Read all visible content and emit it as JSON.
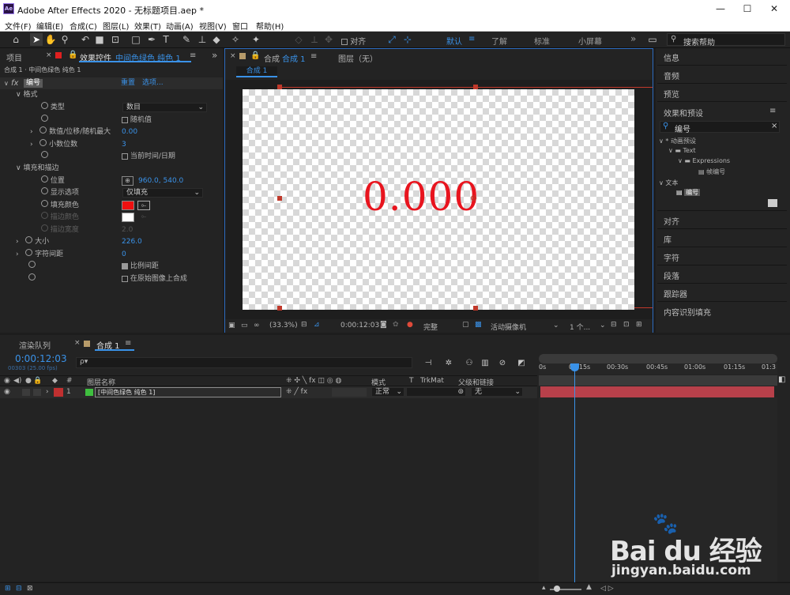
{
  "title": "Adobe After Effects 2020 - 无标题项目.aep *",
  "app_icon": "Ae",
  "window_controls": {
    "minimize": "—",
    "maximize": "☐",
    "close": "✕"
  },
  "menu": [
    "文件(F)",
    "编辑(E)",
    "合成(C)",
    "图层(L)",
    "效果(T)",
    "动画(A)",
    "视图(V)",
    "窗口",
    "帮助(H)"
  ],
  "toolbar": {
    "align_label": "对齐",
    "workspaces": [
      "默认",
      "了解",
      "标准",
      "小屏幕"
    ],
    "more": "»",
    "search_placeholder": "搜索帮助"
  },
  "left_panel": {
    "tab_project": "项目",
    "tab_effects": "效果控件",
    "tab_effects_layer": "中间色绿色 纯色 1",
    "menu_icon": "≡",
    "more": "»",
    "breadcrumb": "合成 1 · 中间色绿色 纯色 1",
    "fx_badge": "fx",
    "effect_name": "编号",
    "reset": "重置",
    "options": "选项...",
    "group_format": "格式",
    "type_label": "类型",
    "type_value": "数目",
    "random_label": "随机值",
    "value_label": "数值/位移/随机最大",
    "value": "0.00",
    "decimals_label": "小数位数",
    "decimals": "3",
    "datetime_label": "当前时间/日期",
    "group_fill": "填充和描边",
    "position_label": "位置",
    "position_value": "960.0, 540.0",
    "display_label": "显示选项",
    "display_value": "仅填充",
    "fill_color_label": "填充颜色",
    "stroke_color_label": "描边颜色",
    "stroke_width_label": "描边宽度",
    "stroke_width": "2.0",
    "size_label": "大小",
    "size": "226.0",
    "tracking_label": "字符间距",
    "tracking": "0",
    "proportional_label": "比例间距",
    "composite_label": "在原始图像上合成"
  },
  "comp_panel": {
    "tab_comp": "合成",
    "tab_comp_name": "合成 1",
    "menu_icon": "≡",
    "layer_tab": "图层（无）",
    "sub_tab": "合成 1",
    "display_text": "0.000",
    "text_color": "#e8141e",
    "zoom": "(33.3%)",
    "timecode": "0:00:12:03",
    "quality": "完整",
    "camera": "活动摄像机",
    "views": "1 个..."
  },
  "right_panel": {
    "items_top": [
      "信息",
      "音频",
      "预览"
    ],
    "effects_title": "效果和预设",
    "menu_icon": "≡",
    "search_value": "编号",
    "tree": [
      "* 动画预设",
      "Text",
      "Expressions",
      "帧编号",
      "文本",
      "编号"
    ],
    "items_bottom": [
      "对齐",
      "库",
      "字符",
      "段落",
      "跟踪器",
      "内容识别填充"
    ]
  },
  "timeline": {
    "tab_render": "渲染队列",
    "tab_comp": "合成 1",
    "menu_icon": "≡",
    "timecode": "0:00:12:03",
    "fps": "00303 (25.00 fps)",
    "search_icon": "ρ▾",
    "col_hash": "#",
    "col_name": "图层名称",
    "col_mode": "模式",
    "col_t": "T",
    "col_trkmat": "TrkMat",
    "col_parent": "父级和链接",
    "layer_index": "1",
    "layer_name": "[中间色绿色 纯色 1]",
    "layer_mode": "正常",
    "layer_parent": "无",
    "label_color": "#3fbf3f",
    "ruler": [
      "0s",
      "00:15s",
      "00:30s",
      "00:45s",
      "01:00s",
      "01:15s",
      "01:3"
    ],
    "playhead_time_fraction": 0.148
  },
  "watermark": {
    "brand": "Bai du 经验",
    "url": "jingyan.baidu.com"
  }
}
